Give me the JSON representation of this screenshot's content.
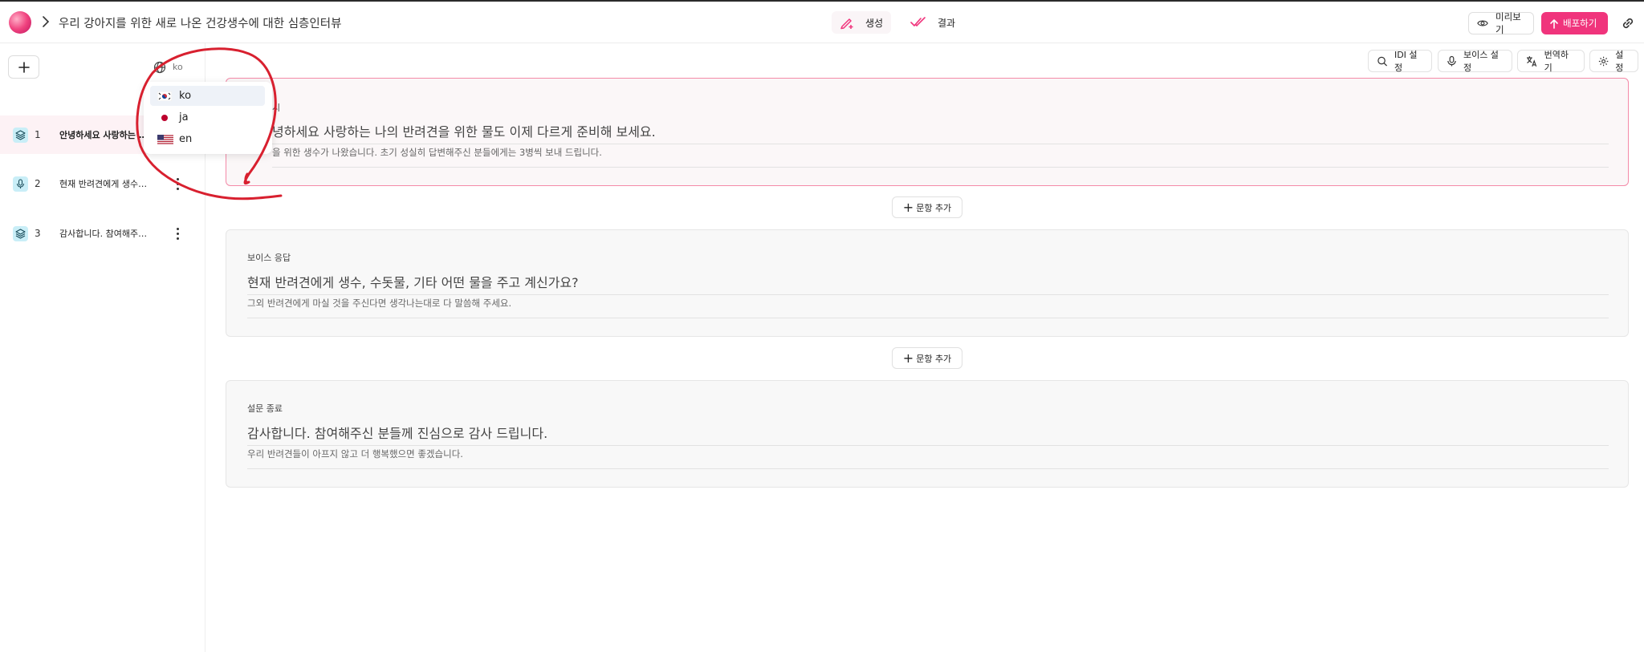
{
  "header": {
    "title": "우리 강아지를 위한 새로 나온 건강생수에 대한 심층인터뷰",
    "tabs": [
      {
        "label": "생성",
        "icon": "pen-sparkle-icon"
      },
      {
        "label": "결과",
        "icon": "double-check-icon"
      }
    ],
    "preview_label": "미리보기",
    "deploy_label": "배포하기"
  },
  "sidebar": {
    "language": {
      "current": "ko",
      "options": [
        {
          "code": "ko",
          "flag": "flag-korea-icon"
        },
        {
          "code": "ja",
          "flag": "flag-japan-icon"
        },
        {
          "code": "en",
          "flag": "flag-usa-icon"
        }
      ]
    },
    "items": [
      {
        "num": "1",
        "label": "안녕하세요 사랑하는 나의 반려견을 위한",
        "icon": "layers-icon"
      },
      {
        "num": "2",
        "label": "현재 반려견에게 생수, 수돗물",
        "icon": "microphone-icon"
      },
      {
        "num": "3",
        "label": "감사합니다. 참여해주신 분들께",
        "icon": "layers-icon"
      }
    ]
  },
  "toolbar": {
    "idi_label": "IDI 설정",
    "voice_label": "보이스 설정",
    "translate_label": "번역하기",
    "settings_label": "설정"
  },
  "cards": [
    {
      "type": "시",
      "question": "녕하세요 사랑하는 나의 반려견을 위한 물도 이제 다르게 준비해 보세요.",
      "desc": "을 위한 생수가 나왔습니다. 초기 성실히 답변해주신 분들에게는 3병씩 보내 드립니다."
    },
    {
      "type": "보이스 응답",
      "question": "현재 반려견에게 생수, 수돗물, 기타 어떤 물을 주고 계신가요?",
      "desc": "그외 반려견에게 마실 것을 주신다면 생각나는대로 다 말씀해 주세요."
    },
    {
      "type": "설문 종료",
      "question": "감사합니다. 참여해주신 분들께 진심으로 감사 드립니다.",
      "desc": "우리 반려견들이 아프지 않고 더 행복했으면 좋겠습니다."
    }
  ],
  "add_statement_label": "문항 추가",
  "colors": {
    "accent": "#f0347c",
    "annotation": "#d8202f",
    "selected_border": "#f48aa8"
  }
}
